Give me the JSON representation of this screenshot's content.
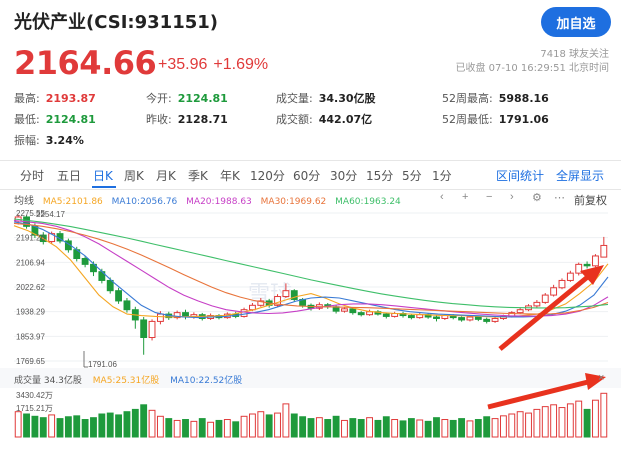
{
  "header": {
    "title": "光伏产业(CSI:931151)",
    "follow_label": "加自选",
    "price": "2164.66",
    "change": "+35.96",
    "change_pct": "+1.69%",
    "followers": "7418 球友关注",
    "close_time": "已收盘 07-10 16:29:51 北京时间"
  },
  "stats": [
    {
      "label": "最高:",
      "value": "2193.87",
      "tone": "red"
    },
    {
      "label": "今开:",
      "value": "2124.81",
      "tone": "green"
    },
    {
      "label": "成交量:",
      "value": "34.30亿股",
      "tone": "dark"
    },
    {
      "label": "52周最高:",
      "value": "5988.16",
      "tone": "dark"
    },
    {
      "label": "最低:",
      "value": "2124.81",
      "tone": "green"
    },
    {
      "label": "昨收:",
      "value": "2128.71",
      "tone": "dark"
    },
    {
      "label": "成交额:",
      "value": "442.07亿",
      "tone": "dark"
    },
    {
      "label": "52周最低:",
      "value": "1791.06",
      "tone": "dark"
    },
    {
      "label": "振幅:",
      "value": "3.24%",
      "tone": "dark"
    }
  ],
  "tabs": [
    "分时",
    "五日",
    "日K",
    "周K",
    "月K",
    "季K",
    "年K",
    "120分",
    "60分",
    "30分",
    "15分",
    "5分",
    "1分"
  ],
  "active_tab": 2,
  "tab_actions": [
    "区间统计",
    "全屏显示"
  ],
  "legend": {
    "label": "均线",
    "items": [
      {
        "text": "MA5:2101.86",
        "color": "#f5a623"
      },
      {
        "text": "MA10:2056.76",
        "color": "#3a7bd5"
      },
      {
        "text": "MA20:1988.63",
        "color": "#c63fc6"
      },
      {
        "text": "MA30:1969.62",
        "color": "#e8743b"
      },
      {
        "text": "MA60:1963.24",
        "color": "#3fbf6a"
      }
    ],
    "tool_icons": [
      "chevron-left-icon",
      "plus-icon",
      "minus-icon",
      "chevron-right-icon",
      "gear-icon"
    ],
    "adjust_label": "前复权"
  },
  "axis": {
    "y_ticks": [
      "2275.55",
      "2191.26",
      "2106.94",
      "2022.62",
      "1938.29",
      "1853.97",
      "1769.65"
    ],
    "top_note": "2254.17",
    "low_note": "1791.06"
  },
  "watermark": "雪球",
  "volume": {
    "label": "成交量 34.3亿股",
    "ma5": "MA5:25.31亿股",
    "ma10": "MA10:22.52亿股",
    "ticks": [
      "3430.42万",
      "1715.21万"
    ]
  },
  "colors": {
    "up": "#e03a3a",
    "down": "#1e9a3c",
    "accent": "#1e6fe0",
    "arrow": "#e8321e"
  },
  "chart_data": {
    "type": "candlestick",
    "series": [
      {
        "name": "MA5",
        "values": [
          2232,
          2215,
          2190,
          2160,
          2115,
          2055,
          1995,
          1955,
          1930,
          1925,
          1922,
          1920,
          1921,
          1922,
          1923,
          1925,
          1935,
          1945,
          1960,
          1975,
          1990,
          2000,
          1985,
          1965,
          1950,
          1940,
          1935,
          1932,
          1930,
          1928,
          1926,
          1925,
          1924,
          1922,
          1920,
          1920,
          1925,
          1930,
          1945,
          1965,
          2000,
          2040,
          2101.86
        ]
      },
      {
        "name": "MA10",
        "values": [
          2245,
          2238,
          2220,
          2195,
          2165,
          2130,
          2085,
          2040,
          2000,
          1960,
          1935,
          1925,
          1920,
          1918,
          1920,
          1922,
          1928,
          1935,
          1945,
          1960,
          1975,
          1985,
          1988,
          1985,
          1975,
          1965,
          1955,
          1945,
          1938,
          1934,
          1930,
          1928,
          1926,
          1924,
          1922,
          1920,
          1920,
          1922,
          1928,
          1940,
          1960,
          1995,
          2056.76
        ]
      },
      {
        "name": "MA20",
        "values": [
          2250,
          2245,
          2240,
          2230,
          2215,
          2195,
          2170,
          2140,
          2110,
          2080,
          2050,
          2020,
          1995,
          1975,
          1958,
          1945,
          1938,
          1934,
          1932,
          1934,
          1940,
          1948,
          1956,
          1962,
          1965,
          1965,
          1962,
          1958,
          1953,
          1948,
          1943,
          1938,
          1934,
          1930,
          1927,
          1924,
          1923,
          1923,
          1925,
          1930,
          1940,
          1960,
          1988.63
        ]
      },
      {
        "name": "MA30",
        "values": [
          2240,
          2236,
          2230,
          2222,
          2212,
          2200,
          2186,
          2170,
          2152,
          2132,
          2110,
          2088,
          2065,
          2043,
          2022,
          2003,
          1988,
          1976,
          1968,
          1962,
          1958,
          1956,
          1955,
          1954,
          1953,
          1952,
          1950,
          1948,
          1946,
          1944,
          1942,
          1940,
          1938,
          1936,
          1934,
          1932,
          1931,
          1930,
          1931,
          1934,
          1942,
          1953,
          1969.62
        ]
      },
      {
        "name": "MA60",
        "values": [
          2255,
          2250,
          2244,
          2237,
          2229,
          2220,
          2210,
          2200,
          2190,
          2179,
          2168,
          2157,
          2146,
          2135,
          2124,
          2113,
          2102,
          2091,
          2080,
          2069,
          2058,
          2047,
          2037,
          2027,
          2017,
          2008,
          1999,
          1991,
          1984,
          1977,
          1971,
          1966,
          1962,
          1958,
          1955,
          1953,
          1952,
          1951,
          1951,
          1952,
          1955,
          1958,
          1963.24
        ]
      }
    ],
    "y_range": [
      1769.65,
      2275.55
    ],
    "candles": [
      [
        2248,
        2262,
        2270,
        2236
      ],
      [
        2262,
        2230,
        2268,
        2222
      ],
      [
        2230,
        2200,
        2240,
        2190
      ],
      [
        2200,
        2178,
        2210,
        2168
      ],
      [
        2178,
        2205,
        2212,
        2170
      ],
      [
        2205,
        2180,
        2214,
        2172
      ],
      [
        2180,
        2150,
        2188,
        2140
      ],
      [
        2150,
        2120,
        2160,
        2110
      ],
      [
        2120,
        2100,
        2128,
        2090
      ],
      [
        2100,
        2075,
        2110,
        2060
      ],
      [
        2075,
        2045,
        2085,
        2035
      ],
      [
        2045,
        2010,
        2055,
        2000
      ],
      [
        2010,
        1975,
        2020,
        1965
      ],
      [
        1975,
        1945,
        1985,
        1935
      ],
      [
        1945,
        1910,
        1955,
        1880
      ],
      [
        1910,
        1850,
        1920,
        1791.06
      ],
      [
        1850,
        1905,
        1912,
        1840
      ],
      [
        1905,
        1930,
        1940,
        1895
      ],
      [
        1930,
        1918,
        1938,
        1910
      ],
      [
        1918,
        1935,
        1942,
        1912
      ],
      [
        1935,
        1920,
        1945,
        1912
      ],
      [
        1920,
        1928,
        1936,
        1914
      ],
      [
        1928,
        1915,
        1934,
        1908
      ],
      [
        1915,
        1925,
        1932,
        1910
      ],
      [
        1925,
        1918,
        1930,
        1912
      ],
      [
        1918,
        1930,
        1936,
        1914
      ],
      [
        1930,
        1922,
        1938,
        1916
      ],
      [
        1922,
        1945,
        1952,
        1918
      ],
      [
        1945,
        1960,
        1968,
        1940
      ],
      [
        1960,
        1975,
        1985,
        1955
      ],
      [
        1975,
        1960,
        1982,
        1952
      ],
      [
        1960,
        1990,
        1998,
        1955
      ],
      [
        1990,
        2010,
        2035,
        1985
      ],
      [
        2010,
        1980,
        2015,
        1972
      ],
      [
        1980,
        1960,
        1985,
        1952
      ],
      [
        1960,
        1950,
        1966,
        1942
      ],
      [
        1950,
        1962,
        1970,
        1944
      ],
      [
        1962,
        1955,
        1968,
        1948
      ],
      [
        1955,
        1940,
        1960,
        1932
      ],
      [
        1940,
        1948,
        1955,
        1935
      ],
      [
        1948,
        1935,
        1952,
        1928
      ],
      [
        1935,
        1928,
        1940,
        1922
      ],
      [
        1928,
        1938,
        1945,
        1924
      ],
      [
        1938,
        1930,
        1944,
        1925
      ],
      [
        1930,
        1922,
        1935,
        1915
      ],
      [
        1922,
        1932,
        1938,
        1918
      ],
      [
        1932,
        1925,
        1938,
        1918
      ],
      [
        1925,
        1918,
        1930,
        1912
      ],
      [
        1918,
        1928,
        1934,
        1914
      ],
      [
        1928,
        1920,
        1932,
        1914
      ],
      [
        1920,
        1915,
        1926,
        1905
      ],
      [
        1915,
        1925,
        1930,
        1910
      ],
      [
        1925,
        1918,
        1930,
        1912
      ],
      [
        1918,
        1910,
        1922,
        1904
      ],
      [
        1910,
        1920,
        1926,
        1905
      ],
      [
        1920,
        1912,
        1925,
        1906
      ],
      [
        1912,
        1905,
        1918,
        1898
      ],
      [
        1905,
        1915,
        1920,
        1900
      ],
      [
        1915,
        1922,
        1928,
        1910
      ],
      [
        1922,
        1935,
        1940,
        1918
      ],
      [
        1935,
        1945,
        1952,
        1930
      ],
      [
        1945,
        1958,
        1964,
        1940
      ],
      [
        1958,
        1970,
        1978,
        1952
      ],
      [
        1970,
        1995,
        2002,
        1965
      ],
      [
        1995,
        2020,
        2030,
        1990
      ],
      [
        2020,
        2045,
        2052,
        2015
      ],
      [
        2045,
        2070,
        2078,
        2040
      ],
      [
        2070,
        2100,
        2106,
        2062
      ],
      [
        2100,
        2095,
        2110,
        2086
      ],
      [
        2095,
        2128.71,
        2135,
        2090
      ],
      [
        2124.81,
        2164.66,
        2193.87,
        2124.81
      ]
    ],
    "volumes": [
      [
        0.55,
        "up"
      ],
      [
        0.5,
        "down"
      ],
      [
        0.45,
        "down"
      ],
      [
        0.42,
        "down"
      ],
      [
        0.48,
        "up"
      ],
      [
        0.4,
        "down"
      ],
      [
        0.44,
        "down"
      ],
      [
        0.46,
        "down"
      ],
      [
        0.38,
        "down"
      ],
      [
        0.42,
        "down"
      ],
      [
        0.5,
        "down"
      ],
      [
        0.52,
        "down"
      ],
      [
        0.48,
        "down"
      ],
      [
        0.55,
        "down"
      ],
      [
        0.6,
        "down"
      ],
      [
        0.7,
        "down"
      ],
      [
        0.58,
        "up"
      ],
      [
        0.45,
        "up"
      ],
      [
        0.4,
        "down"
      ],
      [
        0.36,
        "up"
      ],
      [
        0.38,
        "down"
      ],
      [
        0.34,
        "up"
      ],
      [
        0.4,
        "down"
      ],
      [
        0.32,
        "up"
      ],
      [
        0.36,
        "down"
      ],
      [
        0.38,
        "up"
      ],
      [
        0.33,
        "down"
      ],
      [
        0.45,
        "up"
      ],
      [
        0.5,
        "up"
      ],
      [
        0.55,
        "up"
      ],
      [
        0.48,
        "down"
      ],
      [
        0.52,
        "up"
      ],
      [
        0.72,
        "up"
      ],
      [
        0.5,
        "down"
      ],
      [
        0.44,
        "down"
      ],
      [
        0.4,
        "down"
      ],
      [
        0.42,
        "up"
      ],
      [
        0.38,
        "down"
      ],
      [
        0.45,
        "down"
      ],
      [
        0.36,
        "up"
      ],
      [
        0.4,
        "down"
      ],
      [
        0.38,
        "down"
      ],
      [
        0.42,
        "up"
      ],
      [
        0.36,
        "down"
      ],
      [
        0.44,
        "down"
      ],
      [
        0.38,
        "up"
      ],
      [
        0.35,
        "down"
      ],
      [
        0.4,
        "down"
      ],
      [
        0.37,
        "up"
      ],
      [
        0.34,
        "down"
      ],
      [
        0.42,
        "down"
      ],
      [
        0.38,
        "up"
      ],
      [
        0.36,
        "down"
      ],
      [
        0.4,
        "down"
      ],
      [
        0.35,
        "up"
      ],
      [
        0.38,
        "down"
      ],
      [
        0.44,
        "down"
      ],
      [
        0.4,
        "up"
      ],
      [
        0.46,
        "up"
      ],
      [
        0.5,
        "up"
      ],
      [
        0.55,
        "up"
      ],
      [
        0.52,
        "up"
      ],
      [
        0.6,
        "up"
      ],
      [
        0.66,
        "up"
      ],
      [
        0.7,
        "up"
      ],
      [
        0.64,
        "up"
      ],
      [
        0.72,
        "up"
      ],
      [
        0.78,
        "up"
      ],
      [
        0.6,
        "down"
      ],
      [
        0.8,
        "up"
      ],
      [
        0.95,
        "up"
      ]
    ]
  }
}
